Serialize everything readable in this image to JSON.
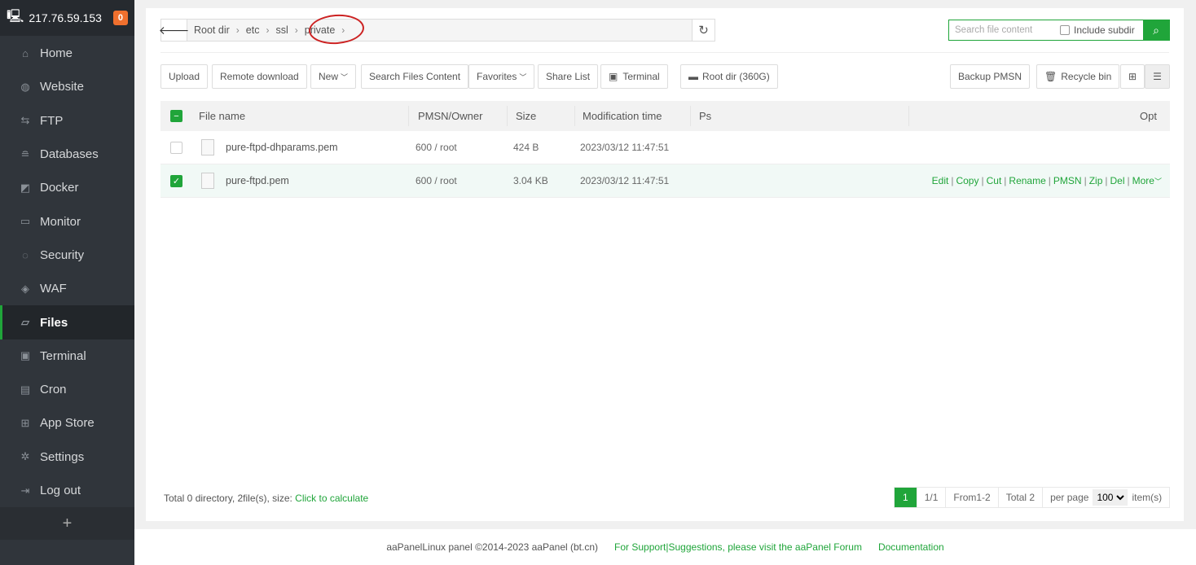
{
  "sidebar": {
    "ip": "217.76.59.153",
    "badge": "0",
    "items": [
      {
        "label": "Home",
        "icon": "home-icon",
        "glyph": "⌂"
      },
      {
        "label": "Website",
        "icon": "globe-icon",
        "glyph": "◍"
      },
      {
        "label": "FTP",
        "icon": "ftp-icon",
        "glyph": "⇆"
      },
      {
        "label": "Databases",
        "icon": "database-icon",
        "glyph": "≘"
      },
      {
        "label": "Docker",
        "icon": "docker-icon",
        "glyph": "◩"
      },
      {
        "label": "Monitor",
        "icon": "monitor-icon",
        "glyph": "▭"
      },
      {
        "label": "Security",
        "icon": "shield-icon",
        "glyph": "◌"
      },
      {
        "label": "WAF",
        "icon": "waf-shield-icon",
        "glyph": "◈"
      },
      {
        "label": "Files",
        "icon": "folder-icon",
        "glyph": "▱"
      },
      {
        "label": "Terminal",
        "icon": "terminal-icon",
        "glyph": "▣"
      },
      {
        "label": "Cron",
        "icon": "calendar-icon",
        "glyph": "▤"
      },
      {
        "label": "App Store",
        "icon": "apps-icon",
        "glyph": "⊞"
      },
      {
        "label": "Settings",
        "icon": "gear-icon",
        "glyph": "✲"
      },
      {
        "label": "Log out",
        "icon": "logout-icon",
        "glyph": "⇥"
      }
    ],
    "add": "+"
  },
  "breadcrumb": [
    "Root dir",
    "etc",
    "ssl",
    "private"
  ],
  "search": {
    "placeholder": "Search file content",
    "include_subdir": "Include subdir"
  },
  "toolbar": {
    "upload": "Upload",
    "remote": "Remote download",
    "new": "New",
    "search_content": "Search Files Content",
    "favorites": "Favorites",
    "share": "Share List",
    "terminal": "Terminal",
    "rootdir": "Root dir (360G)",
    "backup": "Backup PMSN",
    "recycle": "Recycle bin"
  },
  "table": {
    "headers": {
      "name": "File name",
      "perm": "PMSN/Owner",
      "size": "Size",
      "mtime": "Modification time",
      "ps": "Ps",
      "opt": "Opt"
    },
    "rows": [
      {
        "name": "pure-ftpd-dhparams.pem",
        "perm": "600 / root",
        "size": "424 B",
        "mtime": "2023/03/12 11:47:51",
        "selected": false
      },
      {
        "name": "pure-ftpd.pem",
        "perm": "600 / root",
        "size": "3.04 KB",
        "mtime": "2023/03/12 11:47:51",
        "selected": true
      }
    ],
    "ops": [
      "Edit",
      "Copy",
      "Cut",
      "Rename",
      "PMSN",
      "Zip",
      "Del",
      "More"
    ]
  },
  "summary": {
    "text": "Total 0 directory, 2file(s), size:",
    "link": "Click to calculate"
  },
  "pager": {
    "current": "1",
    "pages": "1/1",
    "range": "From1-2",
    "total": "Total 2",
    "per_page_label": "per page",
    "per_page": "100",
    "items": "item(s)"
  },
  "footer": {
    "copyright": "aaPanelLinux panel ©2014-2023 aaPanel (bt.cn)",
    "support": "For Support|Suggestions, please visit the aaPanel Forum",
    "docs": "Documentation"
  },
  "colors": {
    "accent": "#20a53a",
    "sidebar": "#30353b",
    "badge": "#f0702e"
  }
}
